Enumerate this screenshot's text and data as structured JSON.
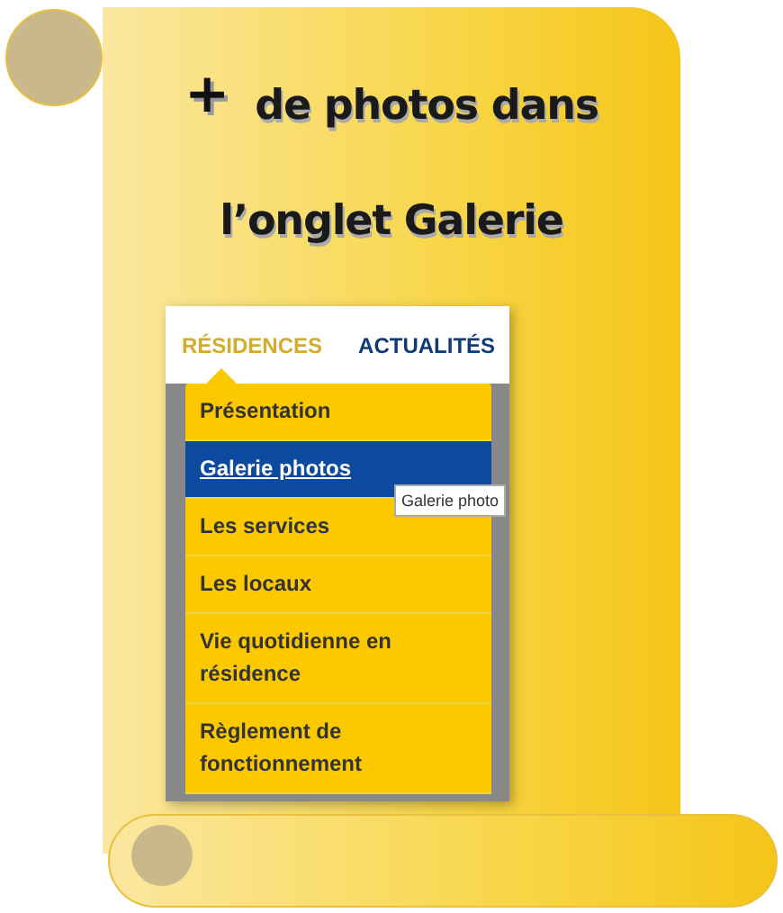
{
  "banner": {
    "plus": "+",
    "lines": [
      "de photos dans",
      "l’onglet Galerie"
    ]
  },
  "nav": {
    "tabs": [
      {
        "label": "RÉSIDENCES",
        "selected": true
      },
      {
        "label": "ACTUALITÉS",
        "selected": false
      }
    ]
  },
  "menu": {
    "items": [
      {
        "label": "Présentation",
        "selected": false
      },
      {
        "label": "Galerie photos",
        "selected": true
      },
      {
        "label": "Les services",
        "selected": false
      },
      {
        "label": "Les locaux",
        "selected": false
      },
      {
        "label": "Vie quotidienne en résidence",
        "selected": false
      },
      {
        "label": "Règlement de fonctionnement",
        "selected": false
      }
    ],
    "tooltip": "Galerie photo"
  }
}
